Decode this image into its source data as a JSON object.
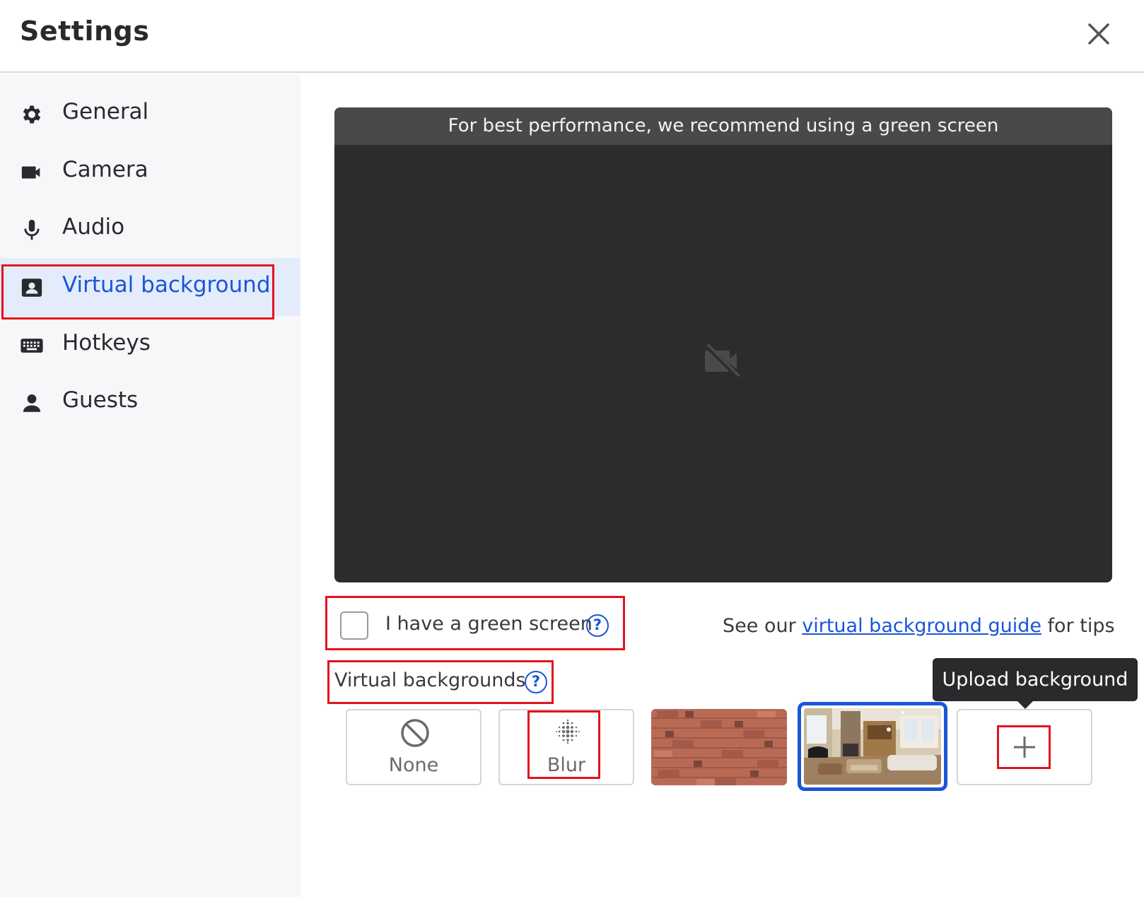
{
  "header": {
    "title": "Settings",
    "close_icon": "close-icon"
  },
  "sidebar": {
    "items": [
      {
        "label": "General",
        "icon": "gear-icon"
      },
      {
        "label": "Camera",
        "icon": "video-camera-icon"
      },
      {
        "label": "Audio",
        "icon": "microphone-icon"
      },
      {
        "label": "Virtual background",
        "icon": "contact-card-icon",
        "active": true
      },
      {
        "label": "Hotkeys",
        "icon": "keyboard-icon"
      },
      {
        "label": "Guests",
        "icon": "person-icon"
      }
    ]
  },
  "preview": {
    "banner": "For best performance, we recommend using a green screen",
    "icon": "camera-off-icon"
  },
  "green_screen": {
    "label": "I have a green screen",
    "checked": false,
    "help_icon": "?"
  },
  "tips": {
    "prefix": "See our ",
    "link": "virtual background guide",
    "suffix": " for tips"
  },
  "virtual_backgrounds": {
    "title": "Virtual backgrounds",
    "help_icon": "?",
    "options": [
      {
        "label": "None",
        "icon": "no-entry-icon"
      },
      {
        "label": "Blur",
        "icon": "blur-dots-icon"
      },
      {
        "label": "",
        "icon": "brick-wall-image"
      },
      {
        "label": "",
        "icon": "living-room-image",
        "selected": true
      },
      {
        "label": "",
        "icon": "plus-icon"
      }
    ],
    "tooltip": "Upload background"
  },
  "colors": {
    "accent": "#1a56d6",
    "highlight": "#e3141e",
    "preview_bg": "#2c2c2e",
    "sidebar_bg": "#f7f7f9"
  }
}
